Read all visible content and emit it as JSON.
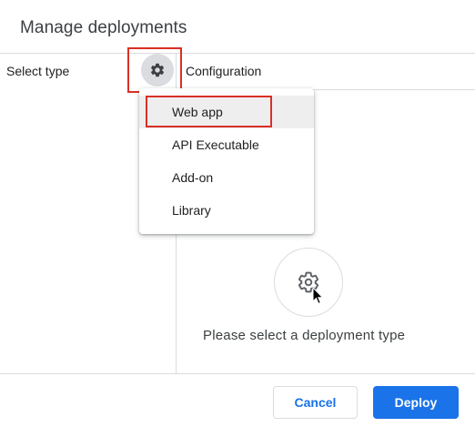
{
  "dialog": {
    "title": "Manage deployments"
  },
  "left_panel": {
    "header": "Select type"
  },
  "right_panel": {
    "header": "Configuration",
    "empty_state_text": "Please select a deployment type"
  },
  "type_menu": {
    "items": [
      {
        "label": "Web app",
        "highlighted": true
      },
      {
        "label": "API Executable"
      },
      {
        "label": "Add-on"
      },
      {
        "label": "Library"
      }
    ]
  },
  "footer": {
    "cancel_label": "Cancel",
    "deploy_label": "Deploy"
  },
  "icons": {
    "type_button": "gear-icon",
    "empty_state": "gear-icon",
    "pointer": "mouse-cursor-icon"
  },
  "colors": {
    "accent": "#1a73e8",
    "highlight_box": "#d93025",
    "divider": "#dadce0"
  }
}
